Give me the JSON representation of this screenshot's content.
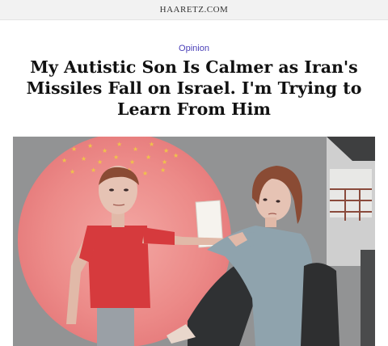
{
  "site": {
    "name": "HAARETZ.COM"
  },
  "article": {
    "kicker": "Opinion",
    "headline": "My Autistic Son Is Calmer as Iran's Missiles Fall on Israel. I'm Trying to Learn From Him"
  },
  "illustration": {
    "colors": {
      "glow": "#ef8d8b",
      "shirt": "#d63a3d",
      "sweater": "#8fa3ad",
      "hair": "#8a4b34",
      "background": "#8b8c8d"
    }
  }
}
